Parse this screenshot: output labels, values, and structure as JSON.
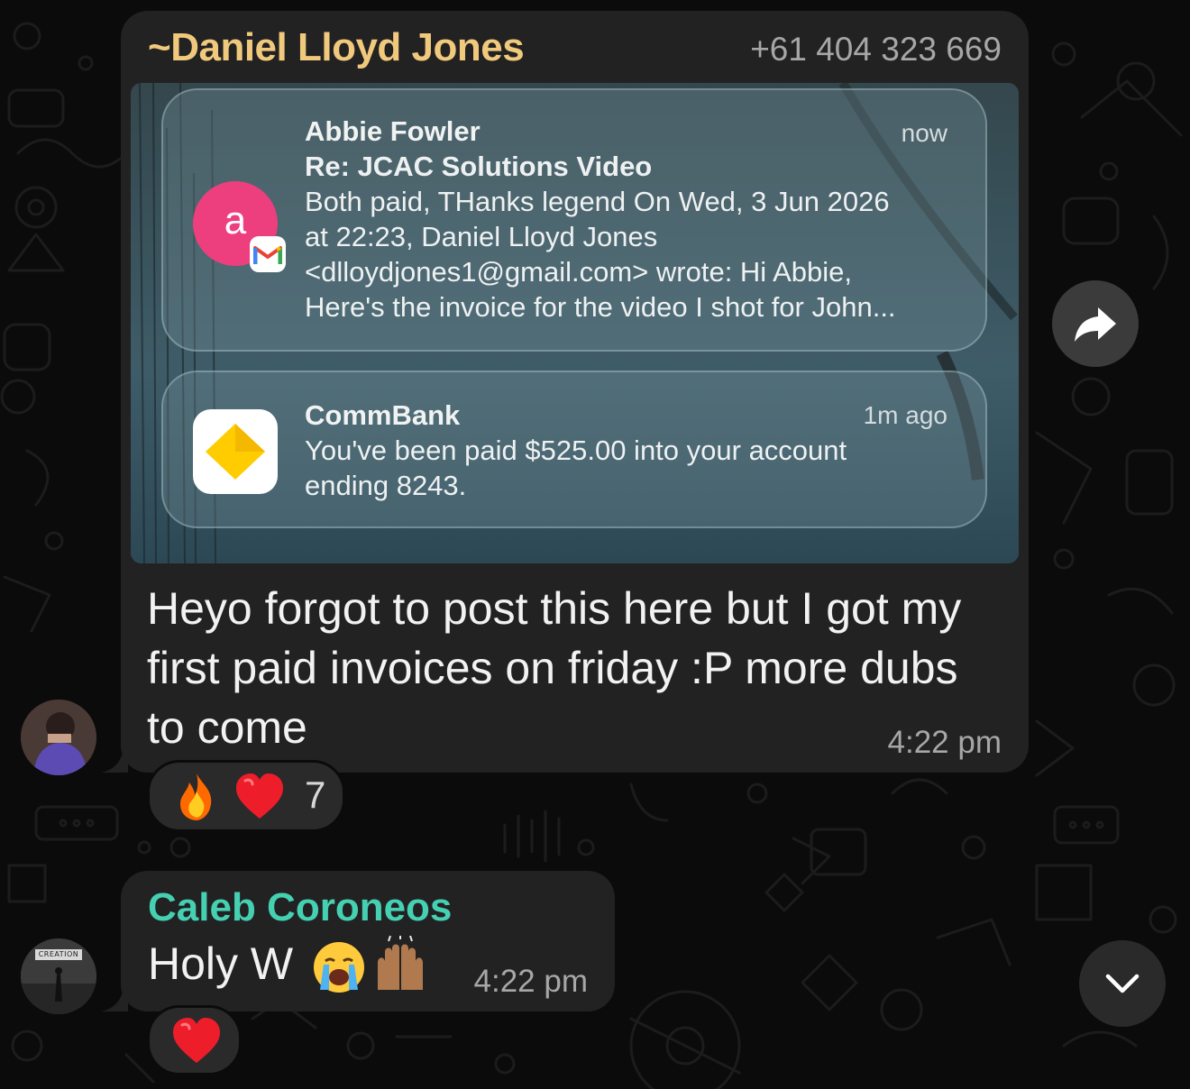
{
  "message_1": {
    "sender_name": "~Daniel Lloyd Jones",
    "sender_phone": "+61 404 323 669",
    "sender_color": "#f0c97d",
    "attachment": {
      "notification_1": {
        "app_icon": "gmail-icon",
        "avatar_letter": "a",
        "title": "Abbie Fowler",
        "time": "now",
        "lines": [
          "Re: JCAC Solutions Video",
          "Both paid, THanks legend On Wed, 3 Jun 2026",
          "at 22:23, Daniel Lloyd Jones",
          "<dlloydjones1@gmail.com> wrote: Hi Abbie,",
          "Here's the invoice for the video I shot for John..."
        ]
      },
      "notification_2": {
        "app_icon": "commbank-icon",
        "title": "CommBank",
        "time": "1m ago",
        "lines": [
          "You've been paid $525.00 into your account",
          "ending 8243."
        ]
      }
    },
    "text_lines": [
      "Heyo forgot to post this here but I got my",
      "first paid invoices on friday :P more dubs",
      "to come"
    ],
    "time": "4:22 pm",
    "reactions": {
      "emojis": [
        "fire",
        "red-heart"
      ],
      "count": "7"
    }
  },
  "message_2": {
    "sender_name": "Caleb Coroneos",
    "sender_color": "#45d0b2",
    "text": "Holy W",
    "emojis": [
      "loudly-crying-face",
      "raising-hands"
    ],
    "time": "4:22 pm",
    "reactions": {
      "emojis": [
        "red-heart"
      ]
    }
  },
  "avatar_2": {
    "caption": "CREATION"
  },
  "controls": {
    "forward_icon": "forward-arrow-icon",
    "scroll_icon": "chevron-down-icon"
  }
}
